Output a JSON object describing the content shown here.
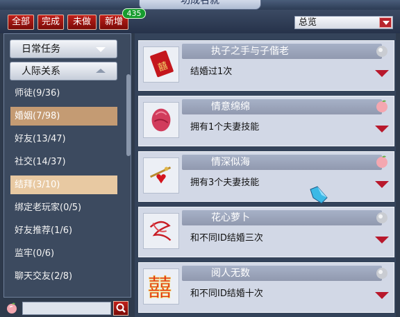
{
  "window": {
    "title": "功成名就"
  },
  "filters": {
    "all": "全部",
    "done": "完成",
    "undone": "未做",
    "new": "新增",
    "new_count": "435"
  },
  "view_select": {
    "selected": "总览"
  },
  "sidebar": {
    "categories": [
      {
        "label": "日常任务",
        "expanded": false
      },
      {
        "label": "人际关系",
        "expanded": true
      }
    ],
    "items": [
      {
        "label": "师徒(9/36)",
        "state": "normal"
      },
      {
        "label": "婚姻(7/98)",
        "state": "selected"
      },
      {
        "label": "好友(13/47)",
        "state": "normal"
      },
      {
        "label": "社交(14/37)",
        "state": "normal"
      },
      {
        "label": "结拜(3/10)",
        "state": "hover"
      },
      {
        "label": "绑定老玩家(0/5)",
        "state": "normal"
      },
      {
        "label": "好友推荐(1/6)",
        "state": "normal"
      },
      {
        "label": "监牢(0/6)",
        "state": "normal"
      },
      {
        "label": "聊天交友(2/8)",
        "state": "normal"
      }
    ]
  },
  "search": {
    "placeholder": "",
    "value": ""
  },
  "achievements": [
    {
      "title": "执子之手与子偕老",
      "desc": "结婚过1次",
      "icon": "red-envelope-icon",
      "medal": "silver"
    },
    {
      "title": "情意绵绵",
      "desc": "拥有1个夫妻技能",
      "icon": "rose-icon",
      "medal": "peach"
    },
    {
      "title": "情深似海",
      "desc": "拥有3个夫妻技能",
      "icon": "heart-pin-icon",
      "medal": "peach"
    },
    {
      "title": "花心萝卜",
      "desc": "和不同ID结婚三次",
      "icon": "red-ribbon-icon",
      "medal": "silver"
    },
    {
      "title": "阅人无数",
      "desc": "和不同ID结婚十次",
      "icon": "double-happiness-icon",
      "medal": "silver"
    }
  ],
  "colors": {
    "accent_red": "#b8182c",
    "selected_item": "#c49b73",
    "hover_item": "#e8c9a2",
    "badge_green": "#169c2e"
  }
}
